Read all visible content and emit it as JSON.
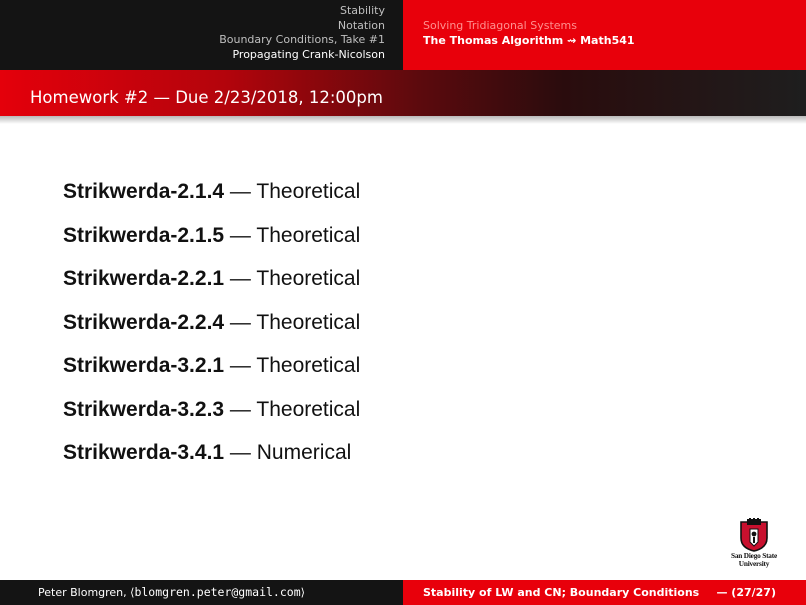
{
  "nav": {
    "sections": [
      {
        "label": "Stability",
        "current": false
      },
      {
        "label": "Notation",
        "current": false
      },
      {
        "label": "Boundary Conditions, Take #1",
        "current": false
      },
      {
        "label": "Propagating Crank-Nicolson",
        "current": true
      }
    ],
    "subsections": [
      {
        "label": "Solving Tridiagonal Systems",
        "current": false
      },
      {
        "label": "The Thomas Algorithm ⇝ Math541",
        "current": true
      }
    ]
  },
  "frame": {
    "title": "Homework #2 — Due 2/23/2018, 12:00pm"
  },
  "homework": [
    {
      "code": "Strikwerda-2.1.4",
      "sep": " — ",
      "type": "Theoretical"
    },
    {
      "code": "Strikwerda-2.1.5",
      "sep": " — ",
      "type": "Theoretical"
    },
    {
      "code": "Strikwerda-2.2.1",
      "sep": " — ",
      "type": "Theoretical"
    },
    {
      "code": "Strikwerda-2.2.4",
      "sep": " — ",
      "type": "Theoretical"
    },
    {
      "code": "Strikwerda-3.2.1",
      "sep": " — ",
      "type": "Theoretical"
    },
    {
      "code": "Strikwerda-3.2.3",
      "sep": " — ",
      "type": "Theoretical"
    },
    {
      "code": "Strikwerda-3.4.1",
      "sep": " — ",
      "type": "Numerical"
    }
  ],
  "logo": {
    "line1": "San Diego State",
    "line2": "University",
    "icon": "sdsu-shield-icon"
  },
  "footer": {
    "author": "Peter Blomgren,",
    "email_open": "⟨",
    "email": "blomgren.peter@gmail.com",
    "email_close": "⟩",
    "talk_title": "Stability of LW and CN; Boundary Conditions",
    "page": "— (27/27)"
  },
  "colors": {
    "accent_red": "#e8000b",
    "dark": "#141414",
    "text": "#111111"
  }
}
